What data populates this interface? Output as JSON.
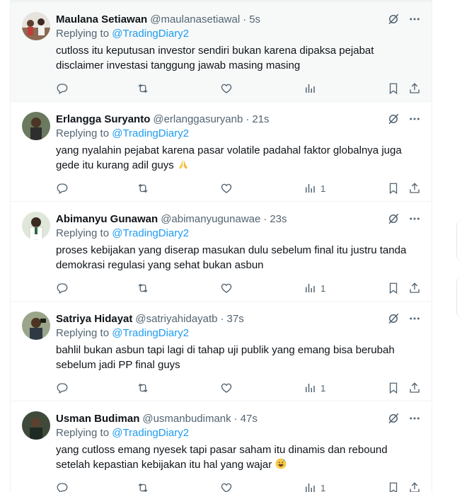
{
  "tweets": [
    {
      "name": "Maulana Setiawan",
      "handle": "@maulanasetiawal",
      "time": "5s",
      "replying_label": "Replying to",
      "mention": "@TradingDiary2",
      "lines": [
        "cutloss itu keputusan investor sendiri bukan karena dipaksa pejabat",
        "disclaimer investasi tanggung jawab masing masing"
      ],
      "views": ""
    },
    {
      "name": "Erlangga Suryanto",
      "handle": "@erlanggasuryanb",
      "time": "21s",
      "replying_label": "Replying to",
      "mention": "@TradingDiary2",
      "lines": [
        "yang nyalahin pejabat karena pasar volatile padahal faktor globalnya juga",
        "gede itu kurang adil guys"
      ],
      "emoji": "folded-hands",
      "views": "1"
    },
    {
      "name": "Abimanyu Gunawan",
      "handle": "@abimanyugunawae",
      "time": "23s",
      "replying_label": "Replying to",
      "mention": "@TradingDiary2",
      "lines": [
        "proses kebijakan yang diserap masukan dulu sebelum final itu justru tanda",
        "demokrasi regulasi yang sehat bukan asbun"
      ],
      "views": "1"
    },
    {
      "name": "Satriya Hidayat",
      "handle": "@satriyahidayatb",
      "time": "37s",
      "replying_label": "Replying to",
      "mention": "@TradingDiary2",
      "lines": [
        "bahlil bukan asbun tapi lagi di tahap uji publik yang emang bisa berubah",
        "sebelum jadi PP final guys"
      ],
      "views": "1"
    },
    {
      "name": "Usman Budiman",
      "handle": "@usmanbudimank",
      "time": "47s",
      "replying_label": "Replying to",
      "mention": "@TradingDiary2",
      "lines": [
        "yang cutloss emang nyesek tapi pasar saham itu dinamis dan rebound",
        "setelah kepastian kebijakan itu hal yang wajar"
      ],
      "emoji": "grinning-sweat",
      "views": "1"
    }
  ],
  "separator": "·",
  "colors": {
    "accent": "#1d9bf0",
    "muted": "#536471",
    "text": "#0f1419",
    "highlight_bg": "#f7f9f9"
  }
}
